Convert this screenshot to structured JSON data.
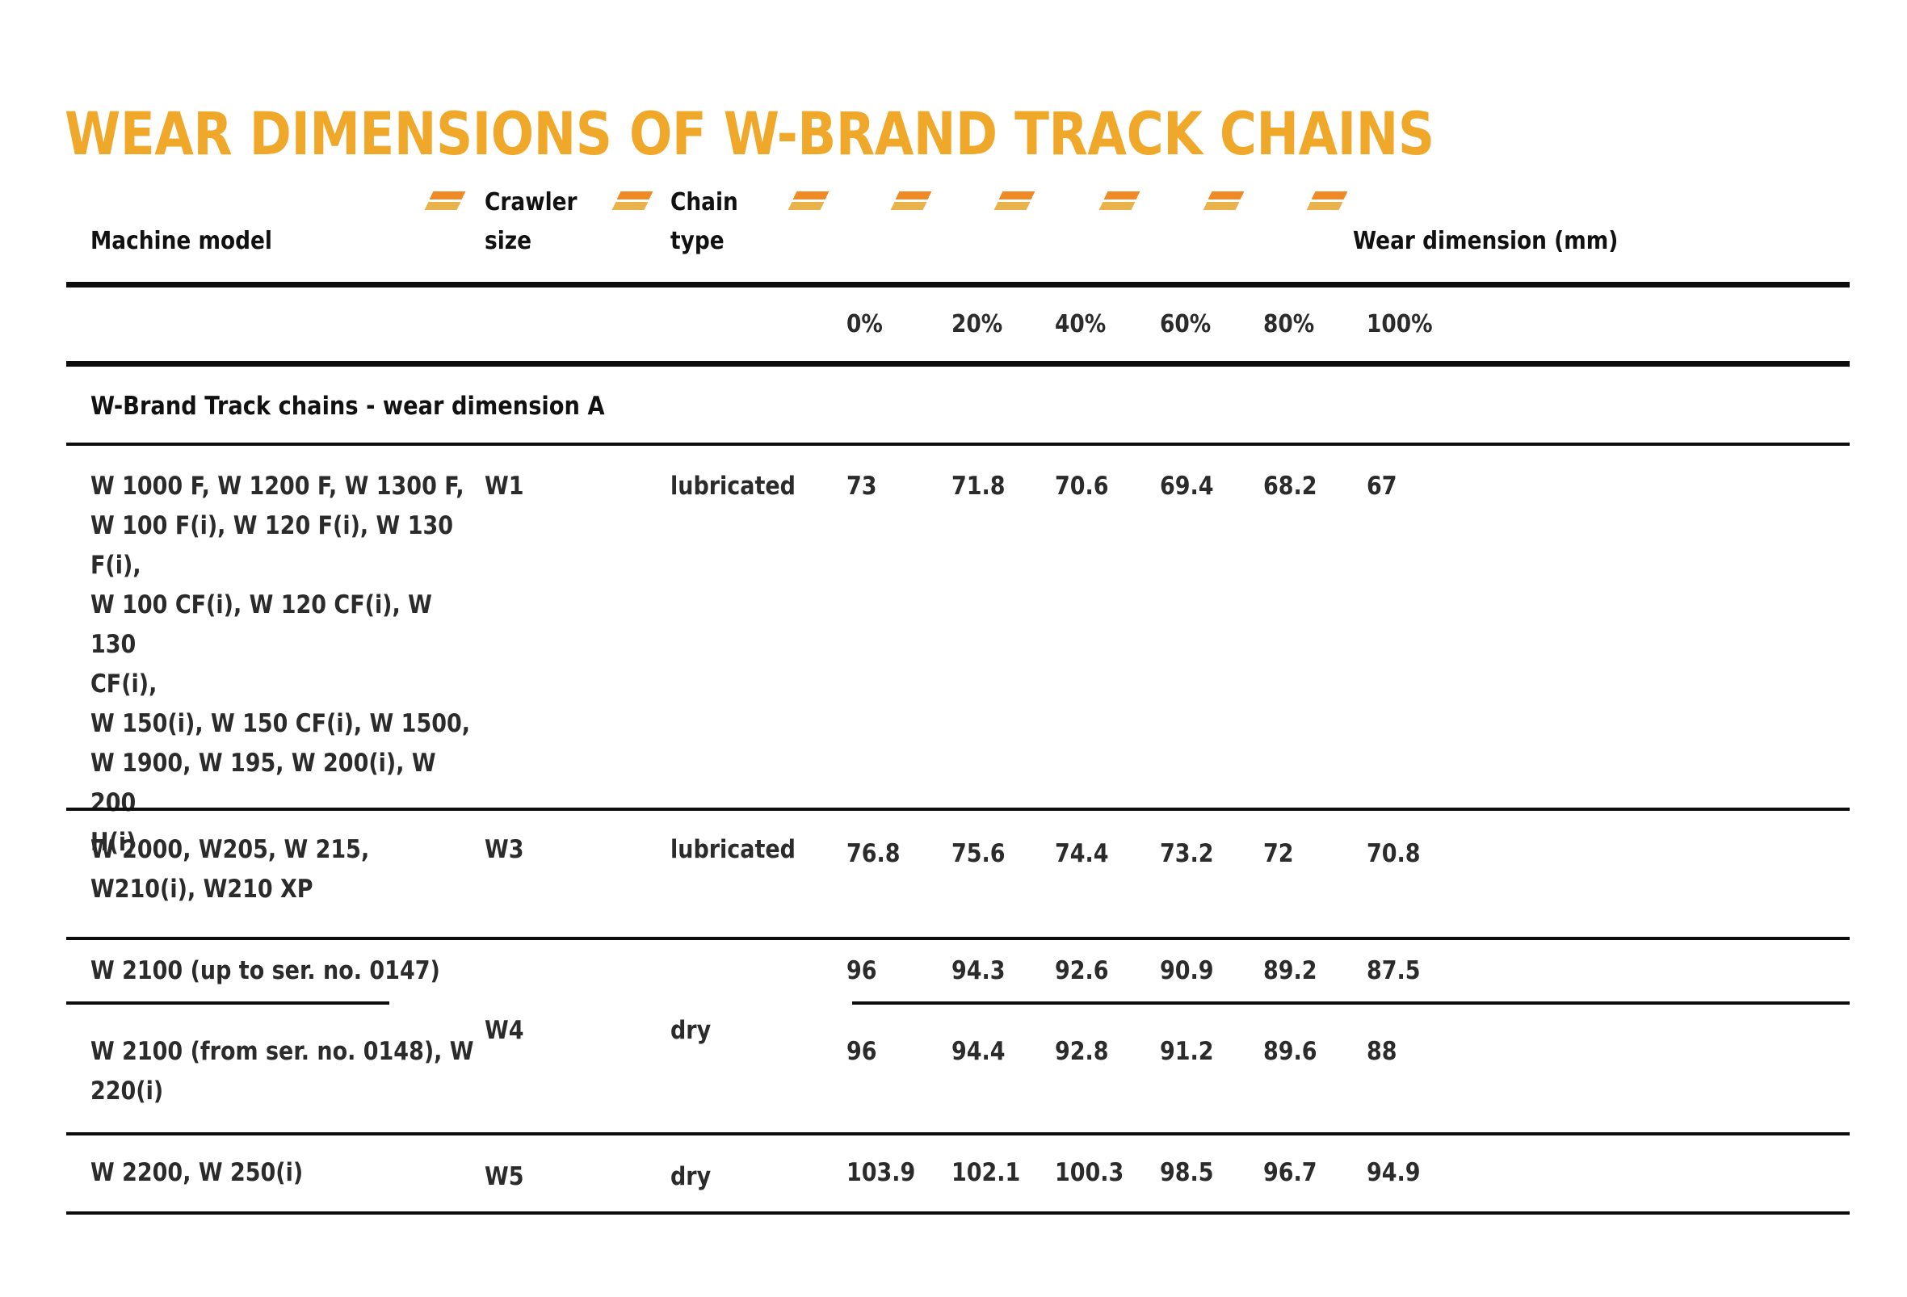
{
  "document": {
    "title": "WEAR DIMENSIONS OF W-BRAND TRACK CHAINS",
    "accent_color": "#EFA829",
    "marker_top_color": "#F08A24",
    "marker_bottom_color": "#E8B34A",
    "text_color": "#2b2b2b",
    "rule_color": "#0d0d0d"
  },
  "table": {
    "headers": {
      "machine_model": "Machine model",
      "crawler_size": "Crawler\nsize",
      "chain_type": "Chain\ntype",
      "wear_dimension": "Wear dimension (mm)"
    },
    "percent_columns": [
      "0%",
      "20%",
      "40%",
      "60%",
      "80%",
      "100%"
    ],
    "section_label": "W-Brand Track chains - wear dimension A",
    "rows": [
      {
        "models": "W 1000 F, W 1200 F, W 1300 F,\nW 100 F(i), W 120 F(i), W 130\nF(i),\nW 100 CF(i), W 120 CF(i), W 130\nCF(i),\nW 150(i), W 150 CF(i), W 1500,\nW 1900, W 195, W 200(i), W 200\nH(i)",
        "crawler_size": "W1",
        "chain_type": "lubricated",
        "values": [
          "73",
          "71.8",
          "70.6",
          "69.4",
          "68.2",
          "67"
        ]
      },
      {
        "models": "W 2000, W205, W 215,\nW210(i), W210 XP",
        "crawler_size": "W3",
        "chain_type": "lubricated",
        "values": [
          "76.8",
          "75.6",
          "74.4",
          "73.2",
          "72",
          "70.8"
        ]
      },
      {
        "models": "W 2100 (up to ser. no. 0147)",
        "crawler_size": "W4",
        "chain_type": "dry",
        "values": [
          "96",
          "94.3",
          "92.6",
          "90.9",
          "89.2",
          "87.5"
        ]
      },
      {
        "models": "W 2100 (from ser. no. 0148), W\n220(i)",
        "crawler_size": "",
        "chain_type": "",
        "values": [
          "96",
          "94.4",
          "92.8",
          "91.2",
          "89.6",
          "88"
        ]
      },
      {
        "models": "W 2200, W 250(i)",
        "crawler_size": "W5",
        "chain_type": "dry",
        "values": [
          "103.9",
          "102.1",
          "100.3",
          "98.5",
          "96.7",
          "94.9"
        ]
      }
    ]
  }
}
